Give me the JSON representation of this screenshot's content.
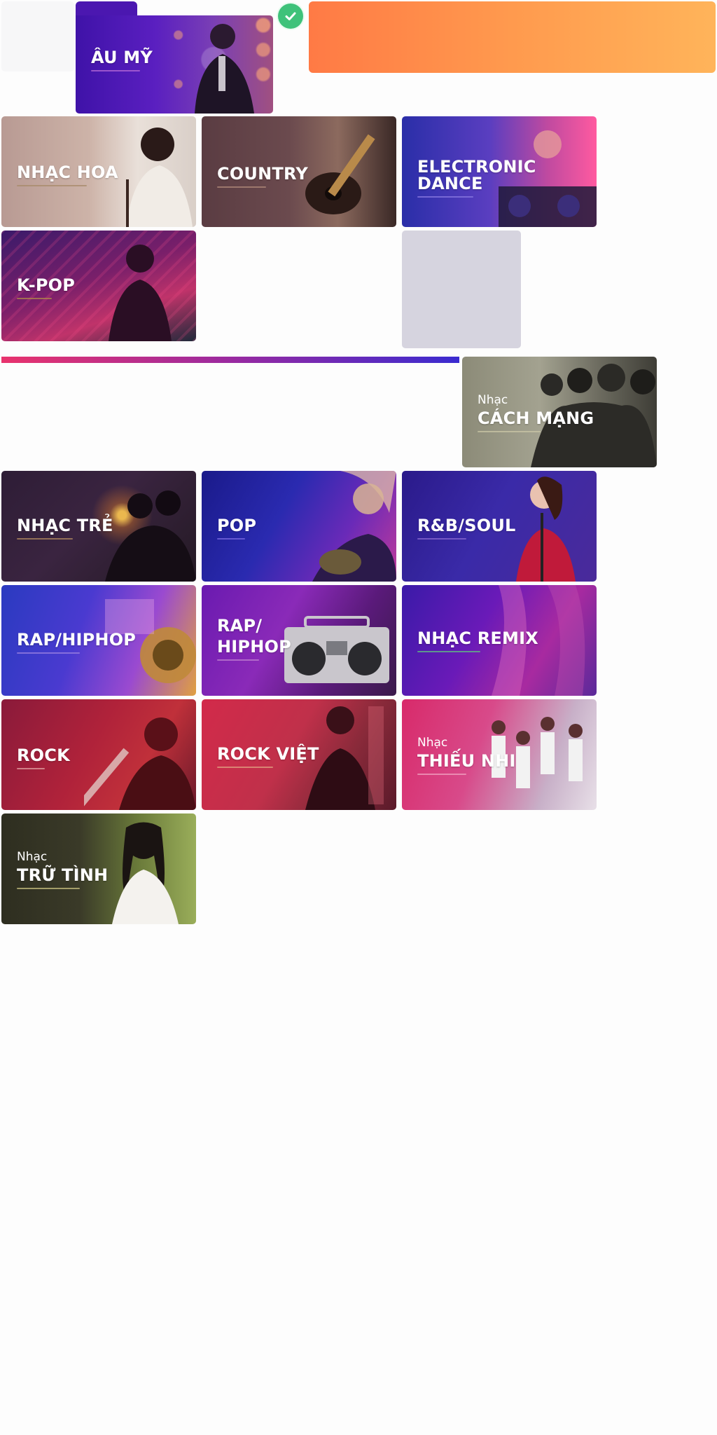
{
  "featured": {
    "label": "ÂU MỸ",
    "selected": true,
    "check_icon": "check-circle-icon"
  },
  "accent": {
    "banner_gradient": [
      "#ff7a45",
      "#ffb45a"
    ],
    "divider_gradient": [
      "#e8336d",
      "#5b2ab8",
      "#3a2bd0"
    ],
    "check_color": "#3fc27a"
  },
  "genres": [
    {
      "id": "nhac-hoa",
      "label": "NHẠC HOA",
      "prefix": ""
    },
    {
      "id": "country",
      "label": "COUNTRY",
      "prefix": ""
    },
    {
      "id": "electronic-dance",
      "label_line1": "ELECTRONIC",
      "label_line2": "DANCE",
      "prefix": ""
    },
    {
      "id": "k-pop",
      "label": "K-POP",
      "prefix": ""
    },
    {
      "id": "cach-mang",
      "label": "CÁCH MẠNG",
      "prefix": "Nhạc"
    },
    {
      "id": "nhac-tre",
      "label": "NHẠC TRẺ",
      "prefix": ""
    },
    {
      "id": "pop",
      "label": "POP",
      "prefix": ""
    },
    {
      "id": "rnb-soul",
      "label": "R&B/SOUL",
      "prefix": ""
    },
    {
      "id": "rap-hiphop",
      "label": "RAP/HIPHOP",
      "prefix": ""
    },
    {
      "id": "rap-hiphop-2",
      "label_line1": "RAP/",
      "label_line2": "HIPHOP",
      "prefix": ""
    },
    {
      "id": "nhac-remix",
      "label": "NHẠC REMIX",
      "prefix": ""
    },
    {
      "id": "rock",
      "label": "ROCK",
      "prefix": ""
    },
    {
      "id": "rock-viet",
      "label": "ROCK VIỆT",
      "prefix": ""
    },
    {
      "id": "thieu-nhi",
      "label": "THIẾU NHI",
      "prefix": "Nhạc"
    },
    {
      "id": "tru-tinh",
      "label": "TRỮ TÌNH",
      "prefix": "Nhạc"
    }
  ]
}
